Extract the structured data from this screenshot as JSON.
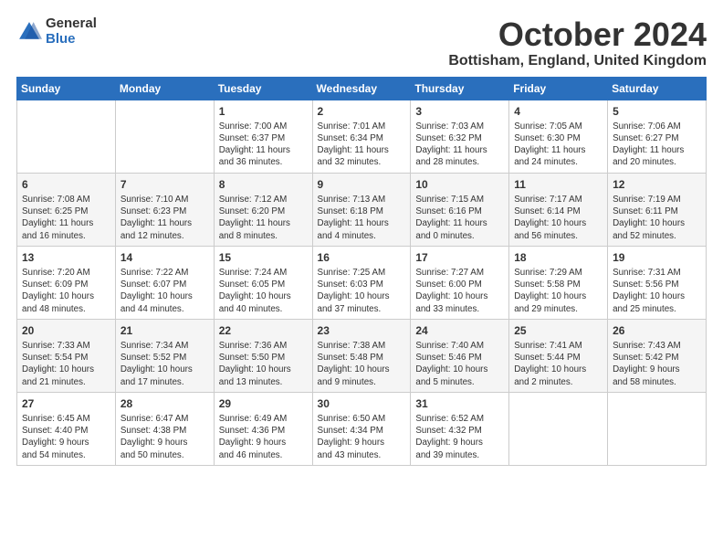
{
  "logo": {
    "general": "General",
    "blue": "Blue"
  },
  "title": {
    "month_year": "October 2024",
    "location": "Bottisham, England, United Kingdom"
  },
  "weekdays": [
    "Sunday",
    "Monday",
    "Tuesday",
    "Wednesday",
    "Thursday",
    "Friday",
    "Saturday"
  ],
  "weeks": [
    [
      {
        "day": "",
        "info": ""
      },
      {
        "day": "",
        "info": ""
      },
      {
        "day": "1",
        "info": "Sunrise: 7:00 AM\nSunset: 6:37 PM\nDaylight: 11 hours\nand 36 minutes."
      },
      {
        "day": "2",
        "info": "Sunrise: 7:01 AM\nSunset: 6:34 PM\nDaylight: 11 hours\nand 32 minutes."
      },
      {
        "day": "3",
        "info": "Sunrise: 7:03 AM\nSunset: 6:32 PM\nDaylight: 11 hours\nand 28 minutes."
      },
      {
        "day": "4",
        "info": "Sunrise: 7:05 AM\nSunset: 6:30 PM\nDaylight: 11 hours\nand 24 minutes."
      },
      {
        "day": "5",
        "info": "Sunrise: 7:06 AM\nSunset: 6:27 PM\nDaylight: 11 hours\nand 20 minutes."
      }
    ],
    [
      {
        "day": "6",
        "info": "Sunrise: 7:08 AM\nSunset: 6:25 PM\nDaylight: 11 hours\nand 16 minutes."
      },
      {
        "day": "7",
        "info": "Sunrise: 7:10 AM\nSunset: 6:23 PM\nDaylight: 11 hours\nand 12 minutes."
      },
      {
        "day": "8",
        "info": "Sunrise: 7:12 AM\nSunset: 6:20 PM\nDaylight: 11 hours\nand 8 minutes."
      },
      {
        "day": "9",
        "info": "Sunrise: 7:13 AM\nSunset: 6:18 PM\nDaylight: 11 hours\nand 4 minutes."
      },
      {
        "day": "10",
        "info": "Sunrise: 7:15 AM\nSunset: 6:16 PM\nDaylight: 11 hours\nand 0 minutes."
      },
      {
        "day": "11",
        "info": "Sunrise: 7:17 AM\nSunset: 6:14 PM\nDaylight: 10 hours\nand 56 minutes."
      },
      {
        "day": "12",
        "info": "Sunrise: 7:19 AM\nSunset: 6:11 PM\nDaylight: 10 hours\nand 52 minutes."
      }
    ],
    [
      {
        "day": "13",
        "info": "Sunrise: 7:20 AM\nSunset: 6:09 PM\nDaylight: 10 hours\nand 48 minutes."
      },
      {
        "day": "14",
        "info": "Sunrise: 7:22 AM\nSunset: 6:07 PM\nDaylight: 10 hours\nand 44 minutes."
      },
      {
        "day": "15",
        "info": "Sunrise: 7:24 AM\nSunset: 6:05 PM\nDaylight: 10 hours\nand 40 minutes."
      },
      {
        "day": "16",
        "info": "Sunrise: 7:25 AM\nSunset: 6:03 PM\nDaylight: 10 hours\nand 37 minutes."
      },
      {
        "day": "17",
        "info": "Sunrise: 7:27 AM\nSunset: 6:00 PM\nDaylight: 10 hours\nand 33 minutes."
      },
      {
        "day": "18",
        "info": "Sunrise: 7:29 AM\nSunset: 5:58 PM\nDaylight: 10 hours\nand 29 minutes."
      },
      {
        "day": "19",
        "info": "Sunrise: 7:31 AM\nSunset: 5:56 PM\nDaylight: 10 hours\nand 25 minutes."
      }
    ],
    [
      {
        "day": "20",
        "info": "Sunrise: 7:33 AM\nSunset: 5:54 PM\nDaylight: 10 hours\nand 21 minutes."
      },
      {
        "day": "21",
        "info": "Sunrise: 7:34 AM\nSunset: 5:52 PM\nDaylight: 10 hours\nand 17 minutes."
      },
      {
        "day": "22",
        "info": "Sunrise: 7:36 AM\nSunset: 5:50 PM\nDaylight: 10 hours\nand 13 minutes."
      },
      {
        "day": "23",
        "info": "Sunrise: 7:38 AM\nSunset: 5:48 PM\nDaylight: 10 hours\nand 9 minutes."
      },
      {
        "day": "24",
        "info": "Sunrise: 7:40 AM\nSunset: 5:46 PM\nDaylight: 10 hours\nand 5 minutes."
      },
      {
        "day": "25",
        "info": "Sunrise: 7:41 AM\nSunset: 5:44 PM\nDaylight: 10 hours\nand 2 minutes."
      },
      {
        "day": "26",
        "info": "Sunrise: 7:43 AM\nSunset: 5:42 PM\nDaylight: 9 hours\nand 58 minutes."
      }
    ],
    [
      {
        "day": "27",
        "info": "Sunrise: 6:45 AM\nSunset: 4:40 PM\nDaylight: 9 hours\nand 54 minutes."
      },
      {
        "day": "28",
        "info": "Sunrise: 6:47 AM\nSunset: 4:38 PM\nDaylight: 9 hours\nand 50 minutes."
      },
      {
        "day": "29",
        "info": "Sunrise: 6:49 AM\nSunset: 4:36 PM\nDaylight: 9 hours\nand 46 minutes."
      },
      {
        "day": "30",
        "info": "Sunrise: 6:50 AM\nSunset: 4:34 PM\nDaylight: 9 hours\nand 43 minutes."
      },
      {
        "day": "31",
        "info": "Sunrise: 6:52 AM\nSunset: 4:32 PM\nDaylight: 9 hours\nand 39 minutes."
      },
      {
        "day": "",
        "info": ""
      },
      {
        "day": "",
        "info": ""
      }
    ]
  ]
}
